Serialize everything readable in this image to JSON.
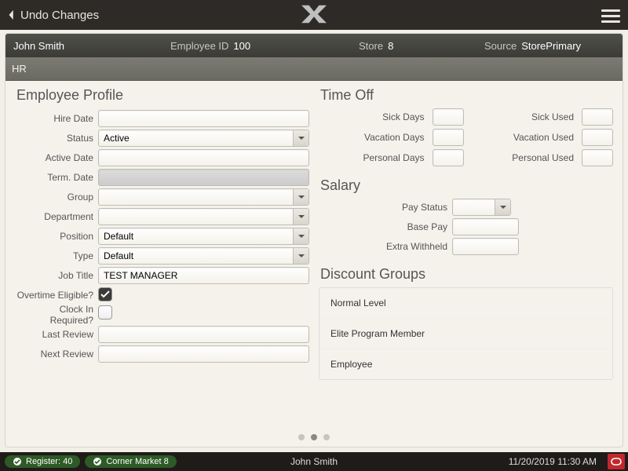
{
  "topbar": {
    "back_label": "Undo Changes"
  },
  "summary": {
    "name": "John Smith",
    "emp_id_label": "Employee ID",
    "emp_id": "100",
    "store_label": "Store",
    "store": "8",
    "source_label": "Source",
    "source": "StorePrimary"
  },
  "tab": "HR",
  "profile": {
    "title": "Employee Profile",
    "labels": {
      "hire_date": "Hire Date",
      "status": "Status",
      "active_date": "Active Date",
      "term_date": "Term. Date",
      "group": "Group",
      "department": "Department",
      "position": "Position",
      "type": "Type",
      "job_title": "Job Title",
      "overtime": "Overtime Eligible?",
      "clockin": "Clock In Required?",
      "last_review": "Last Review",
      "next_review": "Next Review"
    },
    "values": {
      "hire_date": "",
      "status": "Active",
      "active_date": "",
      "term_date": "",
      "group": "",
      "department": "",
      "position": "Default",
      "type": "Default",
      "job_title": "TEST MANAGER",
      "overtime": true,
      "clockin": false,
      "last_review": "",
      "next_review": ""
    }
  },
  "timeoff": {
    "title": "Time Off",
    "labels": {
      "sick": "Sick Days",
      "sick_used": "Sick Used",
      "vac": "Vacation Days",
      "vac_used": "Vacation Used",
      "pers": "Personal Days",
      "pers_used": "Personal Used"
    },
    "values": {
      "sick": "",
      "sick_used": "",
      "vac": "",
      "vac_used": "",
      "pers": "",
      "pers_used": ""
    }
  },
  "salary": {
    "title": "Salary",
    "labels": {
      "pay_status": "Pay Status",
      "base_pay": "Base Pay",
      "extra": "Extra Withheld"
    },
    "values": {
      "pay_status": "",
      "base_pay": "",
      "extra": ""
    }
  },
  "discount": {
    "title": "Discount Groups",
    "items": [
      "Normal Level",
      "Elite Program Member",
      "Employee"
    ]
  },
  "pager": {
    "pages": 3,
    "active": 1
  },
  "status": {
    "register": "Register: 40",
    "store": "Corner Market 8",
    "user": "John Smith",
    "time": "11/20/2019 11:30 AM"
  }
}
